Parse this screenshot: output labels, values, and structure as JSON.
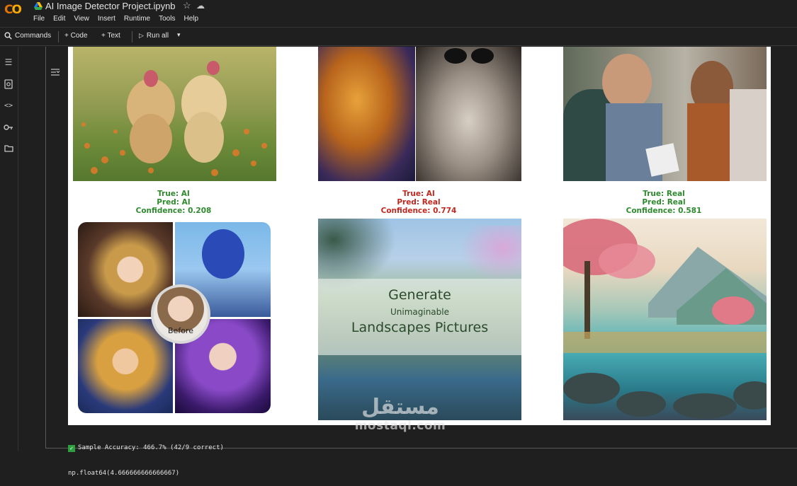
{
  "app": {
    "logo_text": "CO",
    "notebook_title": "AI Image Detector Project.ipynb",
    "menu": [
      "File",
      "Edit",
      "View",
      "Insert",
      "Runtime",
      "Tools",
      "Help"
    ]
  },
  "toolbar": {
    "commands_label": "Commands",
    "code_label": "+ Code",
    "text_label": "+ Text",
    "run_all_label": "Run all"
  },
  "icons": {
    "rail": [
      "toc-icon",
      "find-icon",
      "code-snippets-icon",
      "secrets-key-icon",
      "files-folder-icon"
    ]
  },
  "results": [
    {
      "true_label": "True: AI",
      "pred_label": "Pred: AI",
      "confidence": "Confidence: 0.208",
      "status": "correct"
    },
    {
      "true_label": "True: AI",
      "pred_label": "Pred: Real",
      "confidence": "Confidence: 0.774",
      "status": "incorrect"
    },
    {
      "true_label": "True: Real",
      "pred_label": "Pred: Real",
      "confidence": "Confidence: 0.581",
      "status": "correct"
    }
  ],
  "images": {
    "generate_line1": "Generate",
    "generate_line2": "Unimaginable",
    "generate_line3": "Landscapes Pictures",
    "before_label": "Before"
  },
  "output": {
    "accuracy_line": "Sample Accuracy: 466.7% (42/9 correct)",
    "return_line": "np.float64(4.666666666666667)"
  },
  "watermark": {
    "arabic": "مستقل",
    "latin": "mostaql.com"
  },
  "colors": {
    "correct": "#2f8a2f",
    "incorrect": "#c0281f",
    "logo": "#f9ab00"
  }
}
